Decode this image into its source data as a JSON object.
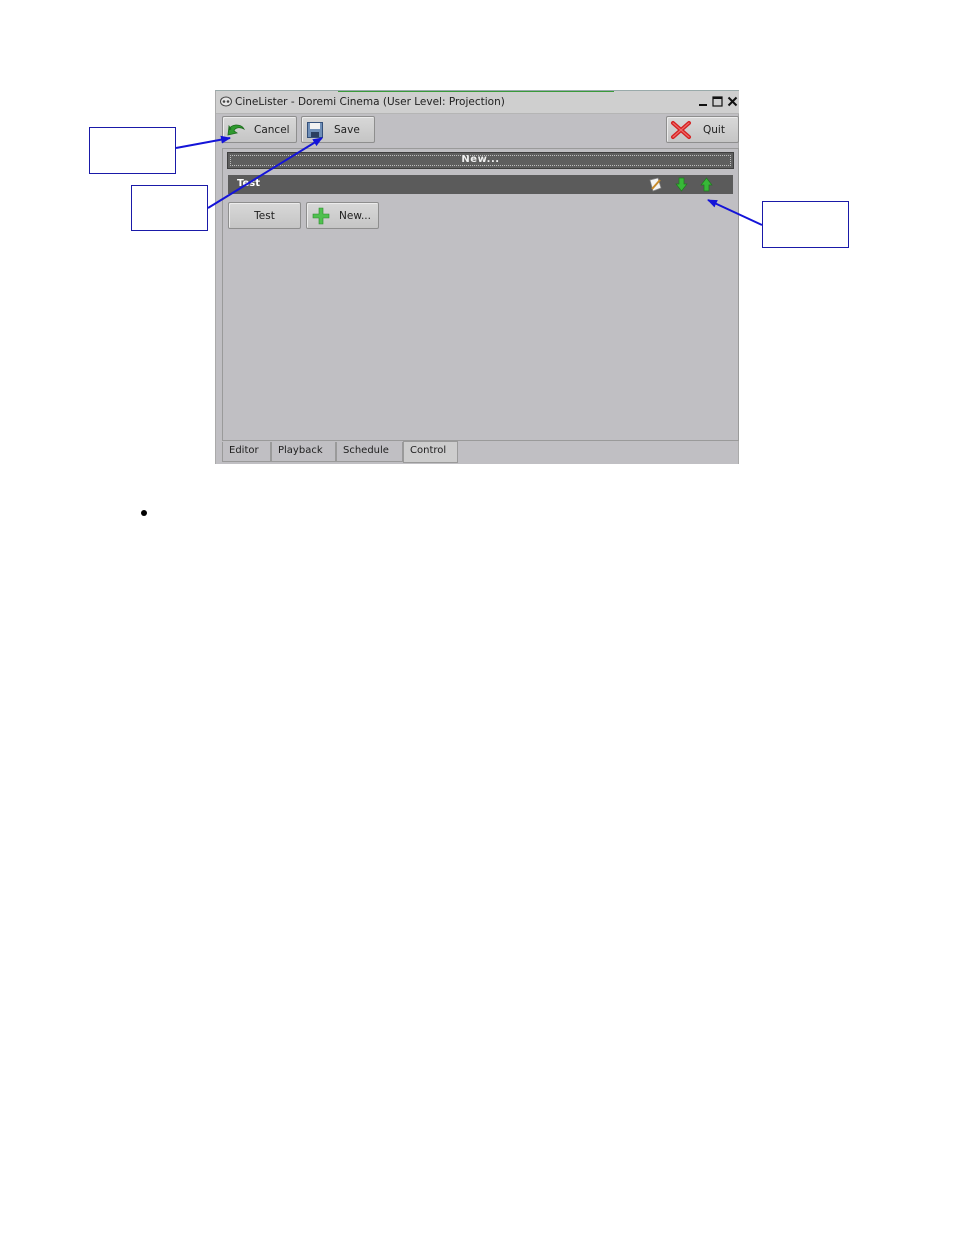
{
  "window": {
    "title": "CineLister - Doremi Cinema (User Level: Projection)",
    "controls": [
      "minimize-icon",
      "maximize-icon",
      "close-icon"
    ]
  },
  "toolbar": {
    "cancel_label": "Cancel",
    "save_label": "Save",
    "quit_label": "Quit"
  },
  "panel": {
    "new_bar_label": "New...",
    "group": {
      "name": "Test",
      "icons": [
        "edit-icon",
        "move-down-icon",
        "move-up-icon"
      ]
    },
    "items": [
      {
        "label": "Test"
      },
      {
        "label": "New...",
        "icon": "add-icon"
      }
    ]
  },
  "tabs": [
    {
      "label": "Editor"
    },
    {
      "label": "Playback"
    },
    {
      "label": "Schedule"
    },
    {
      "label": "Control",
      "active": true
    }
  ],
  "colors": {
    "callout_border": "#1a1aa8",
    "arrow": "#1414d8",
    "dark_bar": "#5b5b5b",
    "window_bg": "#c0bfc3"
  }
}
